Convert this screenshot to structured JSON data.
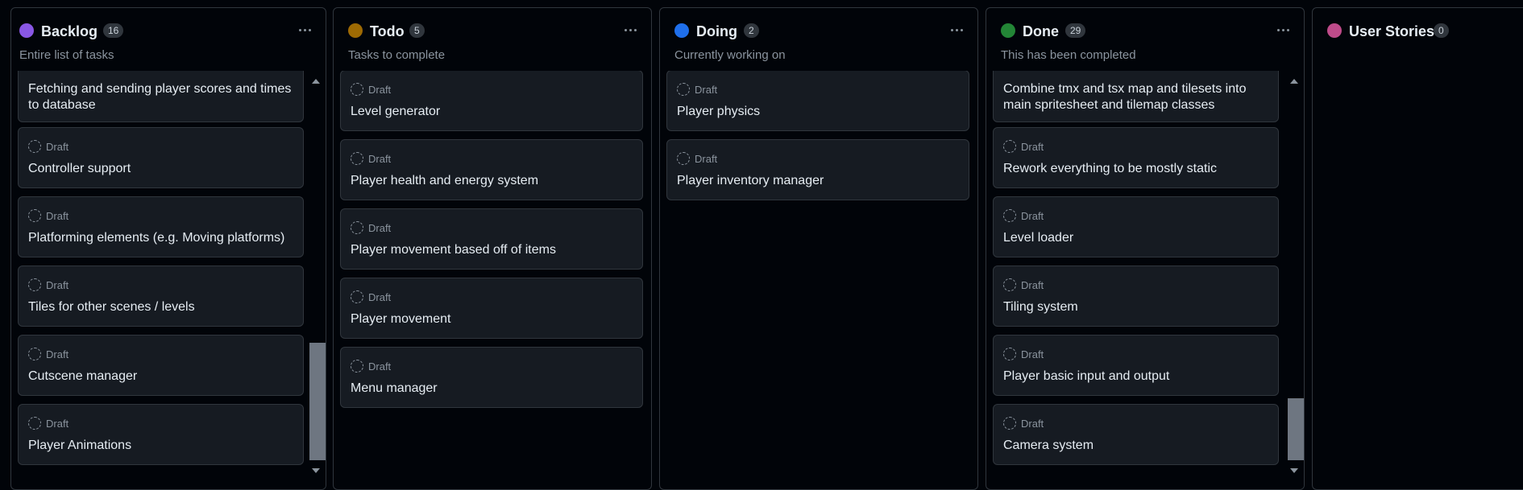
{
  "columns": [
    {
      "title": "Backlog",
      "count": "16",
      "subtitle": "Entire list of tasks",
      "color": "#8957e5",
      "cards": [
        {
          "status": "",
          "title": "Fetching and sending player scores and times to database"
        },
        {
          "status": "Draft",
          "title": "Controller support"
        },
        {
          "status": "Draft",
          "title": "Platforming elements (e.g. Moving platforms)"
        },
        {
          "status": "Draft",
          "title": "Tiles for other scenes / levels"
        },
        {
          "status": "Draft",
          "title": "Cutscene manager"
        },
        {
          "status": "Draft",
          "title": "Player Animations"
        }
      ]
    },
    {
      "title": "Todo",
      "count": "5",
      "subtitle": "Tasks to complete",
      "color": "#9e6a03",
      "cards": [
        {
          "status": "Draft",
          "title": "Level generator"
        },
        {
          "status": "Draft",
          "title": "Player health and energy system"
        },
        {
          "status": "Draft",
          "title": "Player movement based off of items"
        },
        {
          "status": "Draft",
          "title": "Player movement"
        },
        {
          "status": "Draft",
          "title": "Menu manager"
        }
      ]
    },
    {
      "title": "Doing",
      "count": "2",
      "subtitle": "Currently working on",
      "color": "#1f6feb",
      "cards": [
        {
          "status": "Draft",
          "title": "Player physics"
        },
        {
          "status": "Draft",
          "title": "Player inventory manager"
        }
      ]
    },
    {
      "title": "Done",
      "count": "29",
      "subtitle": "This has been completed",
      "color": "#238636",
      "cards": [
        {
          "status": "",
          "title": "Combine tmx and tsx map and tilesets into main spritesheet and tilemap classes"
        },
        {
          "status": "Draft",
          "title": "Rework everything to be mostly static"
        },
        {
          "status": "Draft",
          "title": "Level loader"
        },
        {
          "status": "Draft",
          "title": "Tiling system"
        },
        {
          "status": "Draft",
          "title": "Player basic input and output"
        },
        {
          "status": "Draft",
          "title": "Camera system"
        }
      ]
    },
    {
      "title": "User Stories",
      "count": "0",
      "subtitle": "",
      "color": "#bf4b8a",
      "cards": []
    }
  ],
  "icons": {
    "status_dot": "circle-icon",
    "draft": "draft-icon",
    "menu": "kebab-menu-icon",
    "scroll_up": "chevron-up-icon",
    "scroll_down": "chevron-down-icon"
  }
}
